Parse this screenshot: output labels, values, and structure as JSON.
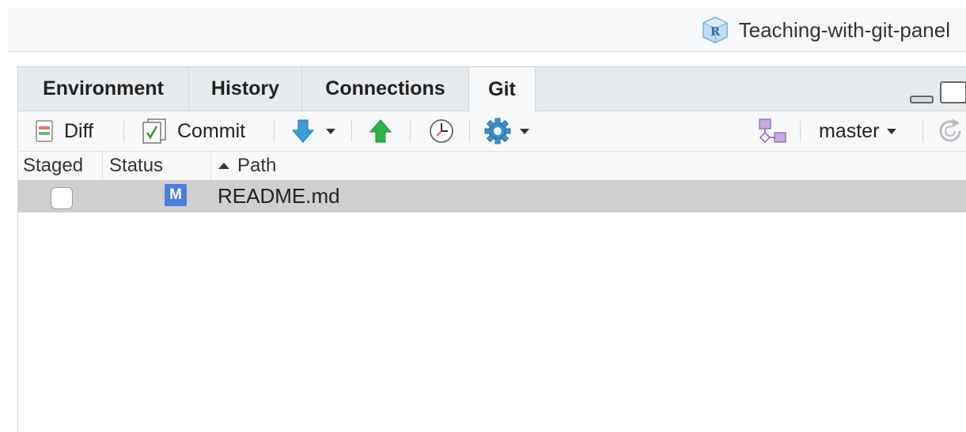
{
  "project": {
    "name": "Teaching-with-git-panel",
    "icon": "r-project-cube-icon"
  },
  "tabs": [
    {
      "label": "Environment",
      "active": false
    },
    {
      "label": "History",
      "active": false
    },
    {
      "label": "Connections",
      "active": false
    },
    {
      "label": "Git",
      "active": true
    }
  ],
  "toolbar": {
    "diff_label": "Diff",
    "commit_label": "Commit",
    "pull_icon": "pull-down-arrow-icon",
    "push_icon": "push-up-arrow-icon",
    "history_icon": "clock-icon",
    "more_icon": "gear-icon",
    "branch_icon": "new-branch-icon",
    "branch_label": "master",
    "refresh_icon": "refresh-icon"
  },
  "columns": {
    "staged": "Staged",
    "status": "Status",
    "path": "Path"
  },
  "files": [
    {
      "staged": false,
      "status": "M",
      "path": "README.md"
    }
  ],
  "colors": {
    "modified_badge": "#4a7fdb",
    "selected_row": "#cfcfcf",
    "push_green": "#2db34a",
    "pull_blue": "#3b9fd8"
  }
}
